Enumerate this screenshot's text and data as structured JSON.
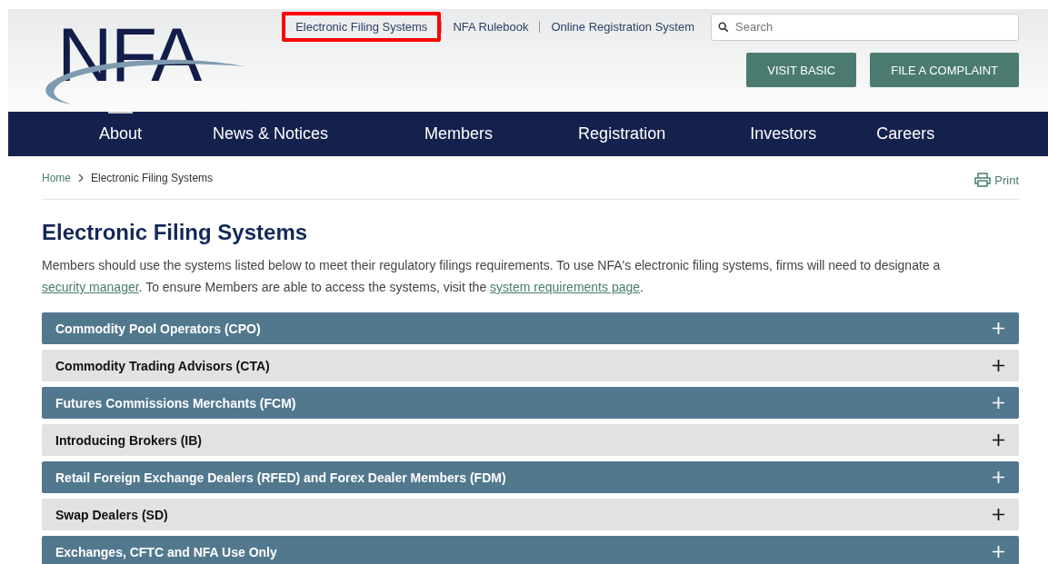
{
  "header": {
    "logo": {
      "text": "NFA"
    },
    "utility_links": [
      {
        "label": "Electronic Filing Systems",
        "highlighted": true
      },
      {
        "label": "NFA Rulebook",
        "highlighted": false
      },
      {
        "label": "Online Registration System",
        "highlighted": false
      }
    ],
    "search": {
      "placeholder": "Search"
    },
    "buttons": [
      "VISIT BASIC",
      "FILE A COMPLAINT"
    ]
  },
  "nav": [
    {
      "label": "About",
      "selected": true
    },
    {
      "label": "News & Notices",
      "selected": false
    },
    {
      "label": "Members",
      "selected": false
    },
    {
      "label": "Registration",
      "selected": false
    },
    {
      "label": "Investors",
      "selected": false
    },
    {
      "label": "Careers",
      "selected": false
    }
  ],
  "breadcrumb": [
    "Home",
    "Electronic Filing Systems"
  ],
  "print": "Print",
  "title": "Electronic Filing Systems",
  "intro": [
    {
      "kind": "text",
      "text": "Members should use the systems listed below to meet their regulatory filings requirements. To use NFA's electronic filing systems, firms will need to designate a "
    },
    {
      "kind": "link",
      "text": "security manager"
    },
    {
      "kind": "text",
      "text": ". To ensure Members are able to access the systems, visit the "
    },
    {
      "kind": "link",
      "text": "system requirements page"
    },
    {
      "kind": "text",
      "text": "."
    }
  ],
  "sections": [
    {
      "label": "Commodity Pool Operators (CPO)",
      "expanded": false
    },
    {
      "label": "Commodity Trading Advisors (CTA)",
      "expanded": false
    },
    {
      "label": "Futures Commissions Merchants (FCM)",
      "expanded": false
    },
    {
      "label": "Introducing Brokers (IB)",
      "expanded": false
    },
    {
      "label": "Retail Foreign Exchange Dealers (RFED) and Forex Dealer Members (FDM)",
      "expanded": false
    },
    {
      "label": "Swap Dealers (SD)",
      "expanded": false
    },
    {
      "label": "Exchanges, CFTC and NFA Use Only",
      "expanded": false
    }
  ]
}
